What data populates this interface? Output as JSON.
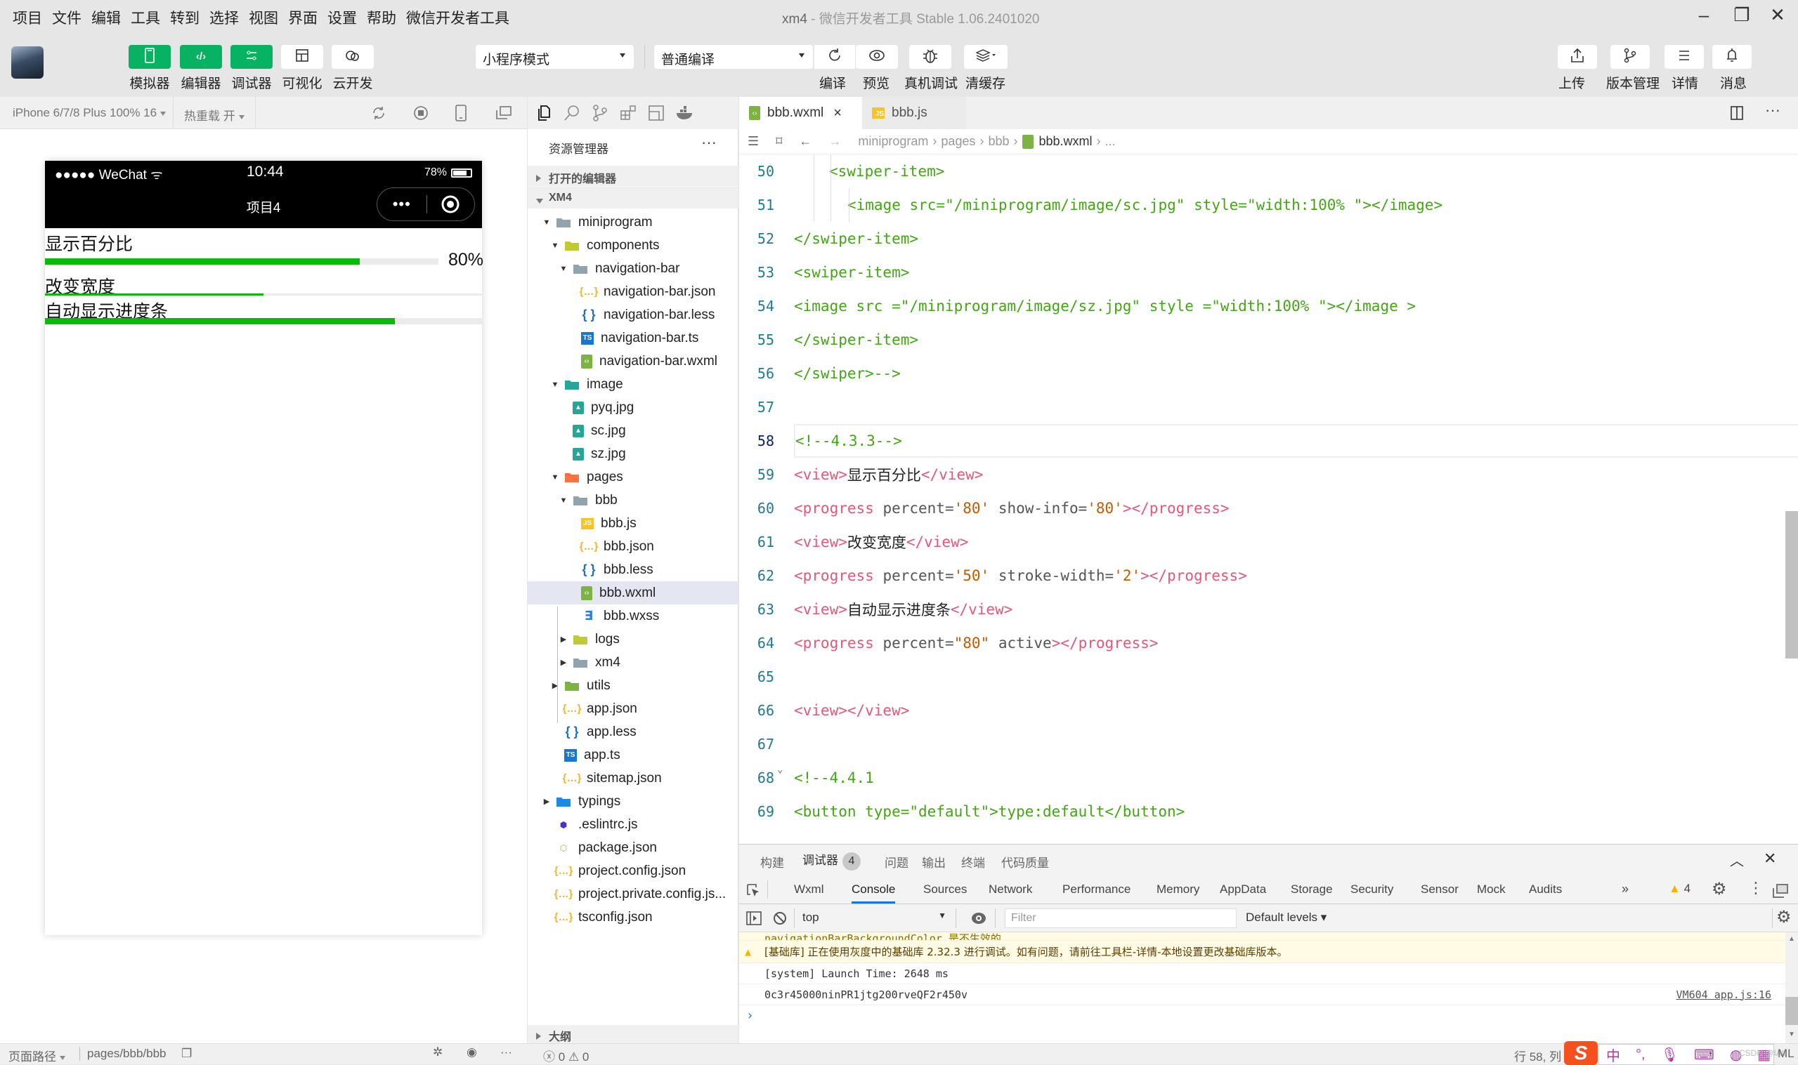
{
  "menu": [
    "项目",
    "文件",
    "编辑",
    "工具",
    "转到",
    "选择",
    "视图",
    "界面",
    "设置",
    "帮助",
    "微信开发者工具"
  ],
  "window": {
    "project": "xm4",
    "title": " - 微信开发者工具 Stable 1.06.2401020"
  },
  "toolbar": {
    "left_buttons": [
      {
        "label": "模拟器",
        "icon": "phone-icon",
        "active": true
      },
      {
        "label": "编辑器",
        "icon": "code-icon",
        "active": true
      },
      {
        "label": "调试器",
        "icon": "debug-toggle-icon",
        "active": true
      },
      {
        "label": "可视化",
        "icon": "layout-icon",
        "active": false
      },
      {
        "label": "云开发",
        "icon": "cloud-icon",
        "active": false
      }
    ],
    "mode_select": "小程序模式",
    "compile_select": "普通编译",
    "mid_buttons": [
      {
        "label": "编译",
        "icon": "refresh-icon"
      },
      {
        "label": "预览",
        "icon": "eye-icon"
      },
      {
        "label": "真机调试",
        "icon": "bug-icon"
      },
      {
        "label": "清缓存",
        "icon": "layers-icon"
      }
    ],
    "right_buttons": [
      {
        "label": "上传",
        "icon": "upload-icon"
      },
      {
        "label": "版本管理",
        "icon": "branch-icon"
      },
      {
        "label": "详情",
        "icon": "menu-icon"
      },
      {
        "label": "消息",
        "icon": "bell-icon"
      }
    ]
  },
  "simulator": {
    "device": "iPhone 6/7/8 Plus 100% 16",
    "hot_reload": "热重载 开",
    "status": {
      "carrier": "●●●●● WeChat",
      "time": "10:44",
      "battery": "78%",
      "battery_level": 0.78
    },
    "nav_title": "项目4",
    "items": [
      {
        "label": "显示百分比",
        "percent": 80,
        "show_info": "80%"
      },
      {
        "label": "改变宽度",
        "percent": 50,
        "stroke_width": 2
      },
      {
        "label": "自动显示进度条",
        "percent": 80,
        "active": true
      }
    ]
  },
  "explorer": {
    "title": "资源管理器",
    "more": "···",
    "open_editors": "打开的编辑器",
    "project": "XM4",
    "outline": "大纲",
    "tree": [
      {
        "name": "miniprogram",
        "depth": 1,
        "type": "folder",
        "icon": "folder-grey",
        "open": true
      },
      {
        "name": "components",
        "depth": 2,
        "type": "folder",
        "icon": "folder-components",
        "open": true
      },
      {
        "name": "navigation-bar",
        "depth": 3,
        "type": "folder",
        "icon": "folder-grey",
        "open": true
      },
      {
        "name": "navigation-bar.json",
        "depth": 4,
        "type": "json"
      },
      {
        "name": "navigation-bar.less",
        "depth": 4,
        "type": "less"
      },
      {
        "name": "navigation-bar.ts",
        "depth": 4,
        "type": "ts"
      },
      {
        "name": "navigation-bar.wxml",
        "depth": 4,
        "type": "wxml"
      },
      {
        "name": "image",
        "depth": 2,
        "type": "folder",
        "icon": "folder-image",
        "open": true
      },
      {
        "name": "pyq.jpg",
        "depth": 3,
        "type": "img"
      },
      {
        "name": "sc.jpg",
        "depth": 3,
        "type": "img"
      },
      {
        "name": "sz.jpg",
        "depth": 3,
        "type": "img"
      },
      {
        "name": "pages",
        "depth": 2,
        "type": "folder",
        "icon": "folder-pages",
        "open": true
      },
      {
        "name": "bbb",
        "depth": 3,
        "type": "folder",
        "icon": "folder-grey",
        "open": true
      },
      {
        "name": "bbb.js",
        "depth": 4,
        "type": "js"
      },
      {
        "name": "bbb.json",
        "depth": 4,
        "type": "json"
      },
      {
        "name": "bbb.less",
        "depth": 4,
        "type": "less"
      },
      {
        "name": "bbb.wxml",
        "depth": 4,
        "type": "wxml",
        "selected": true
      },
      {
        "name": "bbb.wxss",
        "depth": 4,
        "type": "wxss"
      },
      {
        "name": "logs",
        "depth": 3,
        "type": "folder",
        "icon": "folder-logs",
        "open": false
      },
      {
        "name": "xm4",
        "depth": 3,
        "type": "folder",
        "icon": "folder-grey",
        "open": false
      },
      {
        "name": "utils",
        "depth": 2,
        "type": "folder",
        "icon": "folder-utils",
        "open": false
      },
      {
        "name": "app.json",
        "depth": 2,
        "type": "json"
      },
      {
        "name": "app.less",
        "depth": 2,
        "type": "less"
      },
      {
        "name": "app.ts",
        "depth": 2,
        "type": "ts"
      },
      {
        "name": "sitemap.json",
        "depth": 2,
        "type": "json"
      },
      {
        "name": "typings",
        "depth": 1,
        "type": "folder",
        "icon": "folder-typings",
        "open": false
      },
      {
        "name": ".eslintrc.js",
        "depth": 1,
        "type": "eslint"
      },
      {
        "name": "package.json",
        "depth": 1,
        "type": "npm"
      },
      {
        "name": "project.config.json",
        "depth": 1,
        "type": "json"
      },
      {
        "name": "project.private.config.js...",
        "depth": 1,
        "type": "json"
      },
      {
        "name": "tsconfig.json",
        "depth": 1,
        "type": "json"
      }
    ]
  },
  "editor": {
    "tabs": [
      {
        "label": "bbb.wxml",
        "type": "wxml",
        "active": true,
        "close": "×"
      },
      {
        "label": "bbb.js",
        "type": "js",
        "active": false
      }
    ],
    "breadcrumb": [
      "miniprogram",
      "pages",
      "bbb",
      "bbb.wxml",
      "..."
    ],
    "current_line": 58,
    "lines": [
      {
        "n": "50",
        "indent": 3,
        "parts": [
          {
            "c": "g",
            "t": "<swiper-item>"
          }
        ]
      },
      {
        "n": "51",
        "indent": 4,
        "parts": [
          {
            "c": "g",
            "t": "<image src=\"/miniprogram/image/sc.jpg\" style=\"width:100% \"></image>"
          }
        ]
      },
      {
        "n": "52",
        "indent": 0,
        "parts": [
          {
            "c": "g",
            "t": "</swiper-item>"
          }
        ]
      },
      {
        "n": "53",
        "indent": 0,
        "parts": [
          {
            "c": "g",
            "t": "<swiper-item>"
          }
        ]
      },
      {
        "n": "54",
        "indent": 0,
        "parts": [
          {
            "c": "g",
            "t": "<image src =\"/miniprogram/image/sz.jpg\" style =\"width:100% \"></image >"
          }
        ]
      },
      {
        "n": "55",
        "indent": 0,
        "parts": [
          {
            "c": "g",
            "t": "</swiper-item>"
          }
        ]
      },
      {
        "n": "56",
        "indent": 0,
        "parts": [
          {
            "c": "g",
            "t": "</swiper>-->"
          }
        ]
      },
      {
        "n": "57",
        "indent": 0,
        "parts": []
      },
      {
        "n": "58",
        "indent": 0,
        "parts": [
          {
            "c": "g",
            "t": "<!--4.3.3-->"
          }
        ]
      },
      {
        "n": "59",
        "indent": 0,
        "parts": [
          {
            "c": "t",
            "t": "<view>"
          },
          {
            "c": "d",
            "t": "显示百分比"
          },
          {
            "c": "t",
            "t": "</view>"
          }
        ]
      },
      {
        "n": "60",
        "indent": 0,
        "parts": [
          {
            "c": "t",
            "t": "<progress"
          },
          {
            "c": "a",
            "t": " percent="
          },
          {
            "c": "s",
            "t": "'80'"
          },
          {
            "c": "a",
            "t": " show-info="
          },
          {
            "c": "s",
            "t": "'80'"
          },
          {
            "c": "t",
            "t": "></progress>"
          }
        ]
      },
      {
        "n": "61",
        "indent": 0,
        "parts": [
          {
            "c": "t",
            "t": "<view>"
          },
          {
            "c": "d",
            "t": "改变宽度"
          },
          {
            "c": "t",
            "t": "</view>"
          }
        ]
      },
      {
        "n": "62",
        "indent": 0,
        "parts": [
          {
            "c": "t",
            "t": "<progress"
          },
          {
            "c": "a",
            "t": " percent="
          },
          {
            "c": "s",
            "t": "'50'"
          },
          {
            "c": "a",
            "t": " stroke-width="
          },
          {
            "c": "s",
            "t": "'2'"
          },
          {
            "c": "t",
            "t": "></progress>"
          }
        ]
      },
      {
        "n": "63",
        "indent": 0,
        "parts": [
          {
            "c": "t",
            "t": "<view>"
          },
          {
            "c": "d",
            "t": "自动显示进度条"
          },
          {
            "c": "t",
            "t": "</view>"
          }
        ]
      },
      {
        "n": "64",
        "indent": 0,
        "parts": [
          {
            "c": "t",
            "t": "<progress"
          },
          {
            "c": "a",
            "t": " percent="
          },
          {
            "c": "s",
            "t": "\"80\""
          },
          {
            "c": "a",
            "t": " active"
          },
          {
            "c": "t",
            "t": "></progress>"
          }
        ]
      },
      {
        "n": "65",
        "indent": 0,
        "parts": []
      },
      {
        "n": "66",
        "indent": 0,
        "parts": [
          {
            "c": "t",
            "t": "<view></view>"
          }
        ]
      },
      {
        "n": "67",
        "indent": 0,
        "parts": []
      },
      {
        "n": "68",
        "indent": 0,
        "fold": true,
        "parts": [
          {
            "c": "g",
            "t": "<!--4.4.1"
          }
        ]
      },
      {
        "n": "69",
        "indent": 0,
        "parts": [
          {
            "c": "g",
            "t": "<button type=\"default\">type:default</button>"
          }
        ]
      }
    ]
  },
  "debugger": {
    "tabs": [
      {
        "label": "构建"
      },
      {
        "label": "调试器",
        "active": true,
        "badge": "4"
      },
      {
        "label": "问题"
      },
      {
        "label": "输出"
      },
      {
        "label": "终端"
      },
      {
        "label": "代码质量"
      }
    ],
    "devtools_tabs": [
      "Wxml",
      "Console",
      "Sources",
      "Network",
      "Performance",
      "Memory",
      "AppData",
      "Storage",
      "Security",
      "Sensor",
      "Mock",
      "Audits"
    ],
    "active_devtool": "Console",
    "more_tabs": "»",
    "warning_count": "4",
    "context": "top",
    "filter_placeholder": "Filter",
    "levels": "Default levels ▾",
    "logs": [
      {
        "type": "warn-cut",
        "text": "navigationBarBackgroundColor 是不生效的"
      },
      {
        "type": "warn",
        "text": "[基础库] 正在使用灰度中的基础库 2.32.3 进行调试。如有问题，请前往工具栏-详情-本地设置更改基础库版本。"
      },
      {
        "type": "log",
        "text": "[system] Launch Time: 2648 ms"
      },
      {
        "type": "log",
        "text": "0c3r45000ninPR1jtg200rveQF2r450v",
        "source": "VM604 app.js:16"
      }
    ],
    "prompt": "›"
  },
  "statusbar": {
    "page_path_label": "页面路径",
    "page_path": "pages/bbb/bbb",
    "errors": "0",
    "warnings": "0",
    "cursor": "行 58, 列",
    "lang": "ML",
    "watermark": "CSDN @IAlt"
  }
}
